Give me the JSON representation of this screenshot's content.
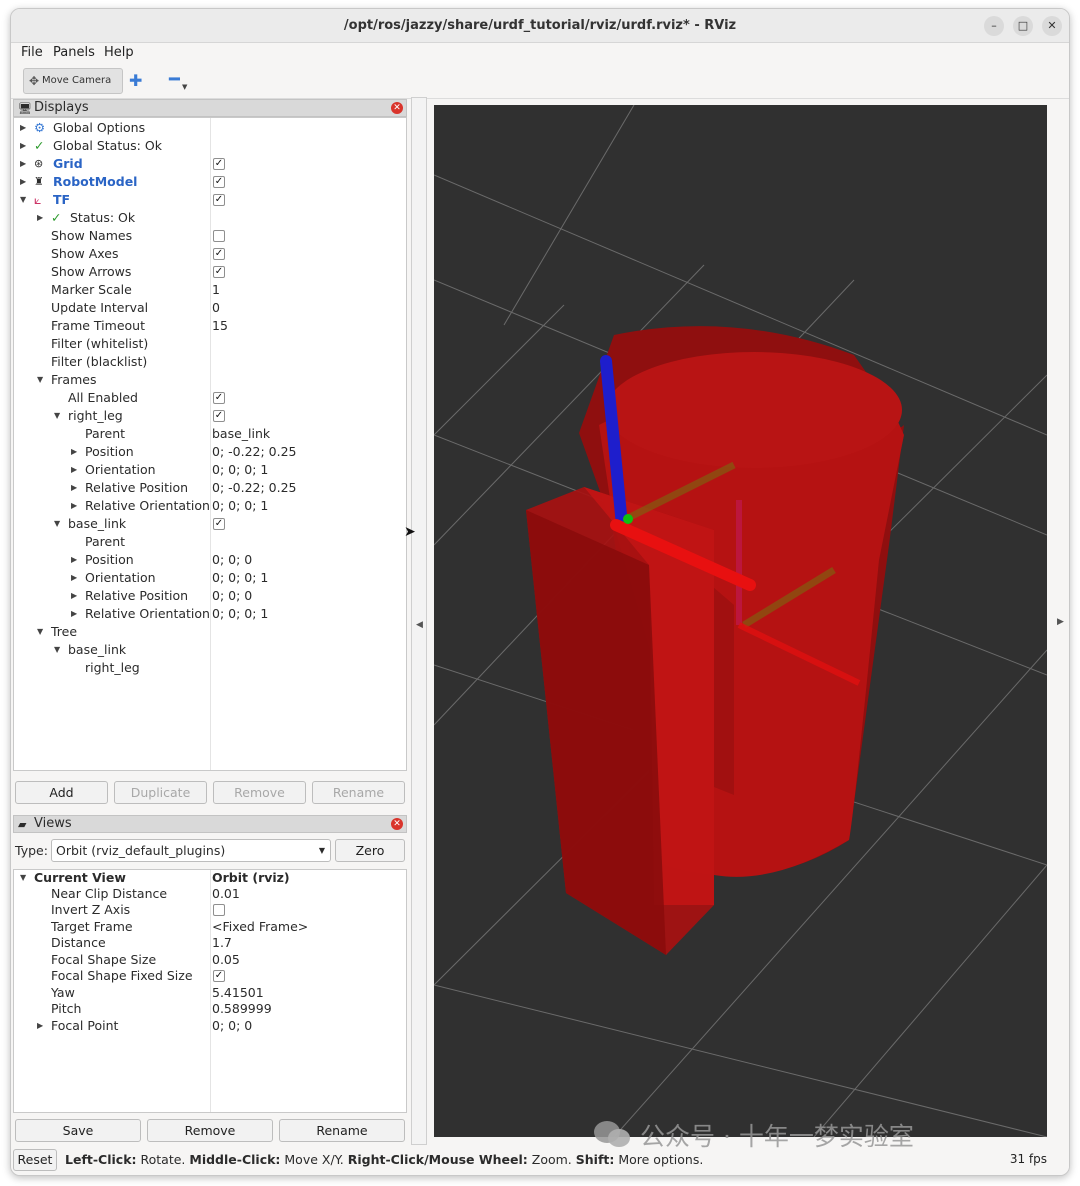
{
  "window": {
    "title": "/opt/ros/jazzy/share/urdf_tutorial/rviz/urdf.rviz* - RViz",
    "controls": [
      "–",
      "□",
      "✕"
    ]
  },
  "menu": {
    "file": "File",
    "panels": "Panels",
    "help": "Help"
  },
  "toolbar": {
    "move_camera": "Move Camera"
  },
  "displays": {
    "title": "Displays",
    "rows": [
      {
        "label": "Global Options"
      },
      {
        "label": "Global Status: Ok"
      },
      {
        "label": "Grid"
      },
      {
        "label": "RobotModel"
      },
      {
        "label": "TF"
      },
      {
        "label": "Status: Ok"
      },
      {
        "label": "Show Names"
      },
      {
        "label": "Show Axes"
      },
      {
        "label": "Show Arrows"
      },
      {
        "label": "Marker Scale",
        "value": "1"
      },
      {
        "label": "Update Interval",
        "value": "0"
      },
      {
        "label": "Frame Timeout",
        "value": "15"
      },
      {
        "label": "Filter (whitelist)"
      },
      {
        "label": "Filter (blacklist)"
      },
      {
        "label": "Frames"
      },
      {
        "label": "All Enabled"
      },
      {
        "label": "right_leg"
      },
      {
        "label": "Parent",
        "value": "base_link"
      },
      {
        "label": "Position",
        "value": "0; -0.22; 0.25"
      },
      {
        "label": "Orientation",
        "value": "0; 0; 0; 1"
      },
      {
        "label": "Relative Position",
        "value": "0; -0.22; 0.25"
      },
      {
        "label": "Relative Orientation",
        "value": "0; 0; 0; 1"
      },
      {
        "label": "base_link"
      },
      {
        "label": "Parent"
      },
      {
        "label": "Position",
        "value": "0; 0; 0"
      },
      {
        "label": "Orientation",
        "value": "0; 0; 0; 1"
      },
      {
        "label": "Relative Position",
        "value": "0; 0; 0"
      },
      {
        "label": "Relative Orientation",
        "value": "0; 0; 0; 1"
      },
      {
        "label": "Tree"
      },
      {
        "label": "base_link"
      },
      {
        "label": "right_leg"
      }
    ],
    "buttons": {
      "add": "Add",
      "duplicate": "Duplicate",
      "remove": "Remove",
      "rename": "Rename"
    }
  },
  "views": {
    "title": "Views",
    "type_label": "Type:",
    "type_value": "Orbit (rviz_default_plugins)",
    "zero": "Zero",
    "rows": [
      {
        "label": "Current View",
        "value": "Orbit (rviz)"
      },
      {
        "label": "Near Clip Distance",
        "value": "0.01"
      },
      {
        "label": "Invert Z Axis"
      },
      {
        "label": "Target Frame",
        "value": "<Fixed Frame>"
      },
      {
        "label": "Distance",
        "value": "1.7"
      },
      {
        "label": "Focal Shape Size",
        "value": "0.05"
      },
      {
        "label": "Focal Shape Fixed Size"
      },
      {
        "label": "Yaw",
        "value": "5.41501"
      },
      {
        "label": "Pitch",
        "value": "0.589999"
      },
      {
        "label": "Focal Point",
        "value": "0; 0; 0"
      }
    ],
    "buttons": {
      "save": "Save",
      "remove": "Remove",
      "rename": "Rename"
    }
  },
  "status": {
    "reset": "Reset",
    "left_click": "Left-Click:",
    "left_action": " Rotate. ",
    "middle_click": "Middle-Click:",
    "middle_action": " Move X/Y. ",
    "right_click": "Right-Click/Mouse Wheel:",
    "right_action": " Zoom. ",
    "shift": "Shift:",
    "shift_action": " More options.",
    "fps": "31 fps"
  },
  "watermark": "公众号 · 十年一梦实验室",
  "colors": {
    "viewport_bg": "#303030",
    "grid": "#6e6e6e",
    "robot_red": "#c81414",
    "axis_x": "#ff0000",
    "axis_y": "#00cc00",
    "axis_z": "#1a1aff",
    "link_blue": "#2a64c5"
  }
}
